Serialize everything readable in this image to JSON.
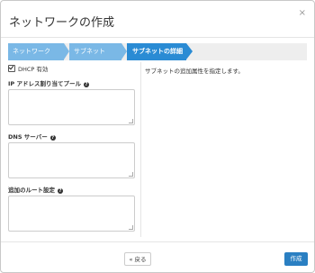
{
  "dialog": {
    "title": "ネットワークの作成",
    "close_glyph": "×"
  },
  "wizard": {
    "steps": [
      {
        "label": "ネットワーク",
        "state": "done"
      },
      {
        "label": "サブネット",
        "state": "done"
      },
      {
        "label": "サブネットの詳細",
        "state": "active"
      }
    ]
  },
  "form": {
    "dhcp": {
      "label": "DHCP 有効",
      "checked": true
    },
    "allocation_pools": {
      "label": "IP アドレス割り当てプール",
      "value": ""
    },
    "dns_servers": {
      "label": "DNS サーバー",
      "value": ""
    },
    "host_routes": {
      "label": "追加のルート設定",
      "value": ""
    },
    "help_glyph": "?"
  },
  "description": "サブネットの追加属性を指定します。",
  "footer": {
    "back_label": "« 戻る",
    "create_label": "作成"
  },
  "colors": {
    "step_done": "#7ab8e6",
    "step_active": "#2a8bd4",
    "wizard_bg": "#eeeeee",
    "primary_button": "#2a7fc2"
  }
}
